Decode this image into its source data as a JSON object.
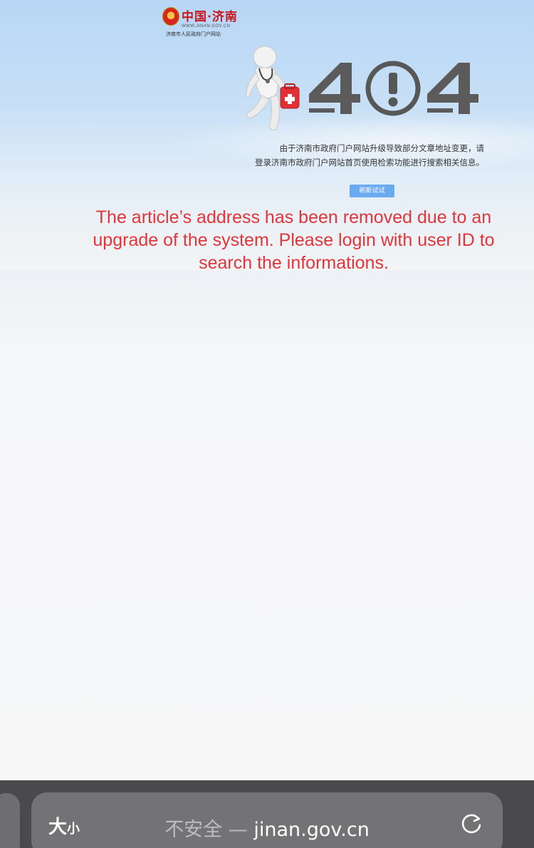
{
  "page": {
    "logo": {
      "title": "中国·济南",
      "url": "WWW.JINAN.GOV.CN",
      "subtitle": "济南市人民政府门户网站",
      "emblem_icon": "national-emblem-icon"
    },
    "error_code": "404",
    "message_cn_line1": "由于济南市政府门户网站升级导致部分文章地址变更，请",
    "message_cn_line2": "登录济南市政府门户网站首页使用检索功能进行搜索相关信息。",
    "retry_button": "刷新试试",
    "message_en": "The article’s address has been removed due to an upgrade of the system. Please login with user ID to search the informations."
  },
  "browser": {
    "text_size_big": "大",
    "text_size_small": "小",
    "security_label": "不安全 —",
    "domain": "jinan.gov.cn",
    "reload_icon": "reload-icon"
  },
  "colors": {
    "english_message": "#e0353a",
    "retry_button_bg": "#6aaaf0",
    "browser_bar": "#4a4a4c",
    "address_pill": "#737376"
  }
}
